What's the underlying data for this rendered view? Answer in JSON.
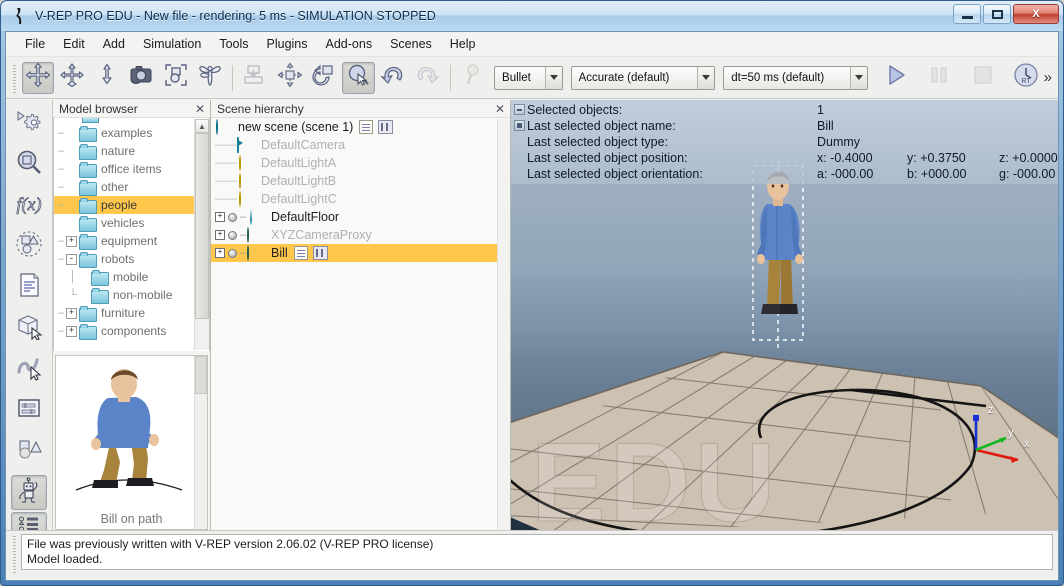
{
  "window": {
    "title": "V-REP PRO EDU - New file - rendering: 5 ms - SIMULATION STOPPED",
    "app_icon": "vrep-logo-icon",
    "minimize_label": "Minimize",
    "maximize_label": "Maximize",
    "close_label": "X"
  },
  "menubar": {
    "items": [
      {
        "label": "File"
      },
      {
        "label": "Edit"
      },
      {
        "label": "Add"
      },
      {
        "label": "Simulation"
      },
      {
        "label": "Tools"
      },
      {
        "label": "Plugins"
      },
      {
        "label": "Add-ons"
      },
      {
        "label": "Scenes"
      },
      {
        "label": "Help"
      }
    ]
  },
  "toolbar": {
    "buttons": [
      {
        "name": "object-shift-button",
        "icon": "four-way-arrows-icon",
        "state": "active"
      },
      {
        "name": "object-rotate-button",
        "icon": "rotate-arrows-icon",
        "state": "normal"
      },
      {
        "name": "camera-shift-button",
        "icon": "vertical-arrow-icon",
        "state": "normal"
      },
      {
        "name": "camera-button",
        "icon": "camera-icon",
        "state": "normal"
      },
      {
        "name": "fit-to-view-button",
        "icon": "bounding-box-icon",
        "state": "normal"
      },
      {
        "name": "fly-camera-button",
        "icon": "dragonfly-icon",
        "state": "normal"
      },
      {
        "name": "assemble-button",
        "icon": "assemble-icon",
        "state": "disabled"
      },
      {
        "name": "translate-tool-button",
        "icon": "move-object-icon",
        "state": "normal"
      },
      {
        "name": "rotate-tool-button",
        "icon": "rotate-object-icon",
        "state": "normal"
      },
      {
        "name": "selection-button",
        "icon": "select-cursor-icon",
        "state": "active"
      },
      {
        "name": "undo-button",
        "icon": "undo-arrow-icon",
        "state": "normal"
      },
      {
        "name": "redo-button",
        "icon": "redo-arrow-icon",
        "state": "disabled"
      },
      {
        "name": "page-selector-button",
        "icon": "pin-icon",
        "state": "disabled"
      }
    ],
    "engine_select": {
      "value": "Bullet",
      "name": "physics-engine-select"
    },
    "accuracy_select": {
      "value": "Accurate (default)",
      "name": "engine-accuracy-select"
    },
    "dt_select": {
      "value": "dt=50 ms (default)",
      "name": "simulation-timestep-select"
    },
    "start_button": {
      "name": "start-simulation-button",
      "icon": "play-icon"
    },
    "pause_button": {
      "name": "pause-simulation-button",
      "icon": "pause-icon"
    },
    "stop_button": {
      "name": "stop-simulation-button",
      "icon": "stop-icon"
    },
    "realtime_button": {
      "name": "realtime-mode-button",
      "icon": "clock-rt-icon",
      "badge": "RT"
    },
    "overflow": {
      "label": "»",
      "name": "toolbar-overflow-button"
    }
  },
  "vertical_toolbar": {
    "buttons": [
      {
        "name": "scene-object-properties-button",
        "icon": "gear-play-icon",
        "state": "normal"
      },
      {
        "name": "calculation-modules-button",
        "icon": "magnifier-cube-icon",
        "state": "normal"
      },
      {
        "name": "user-parameters-button",
        "icon": "fx-function-icon",
        "state": "normal"
      },
      {
        "name": "collection-button",
        "icon": "shapes-dashed-icon",
        "state": "normal"
      },
      {
        "name": "scripts-button",
        "icon": "script-page-icon",
        "state": "normal"
      },
      {
        "name": "shape-edit-button",
        "icon": "cube-cursor-icon",
        "state": "normal"
      },
      {
        "name": "path-edit-button",
        "icon": "path-cursor-icon",
        "state": "normal"
      },
      {
        "name": "dialog-button",
        "icon": "slider-dialog-icon",
        "state": "normal"
      },
      {
        "name": "geometry-button",
        "icon": "shapes-solid-icon",
        "state": "normal"
      },
      {
        "name": "model-browser-toggle-button",
        "icon": "robot-icon",
        "state": "active"
      },
      {
        "name": "scene-hierarchy-toggle-button",
        "icon": "hierarchy-list-icon",
        "state": "active"
      }
    ]
  },
  "model_browser": {
    "title": "Model browser",
    "close_label": "✕",
    "folders": [
      {
        "label": "examples",
        "expander": "",
        "selected": false,
        "indent": 0
      },
      {
        "label": "nature",
        "expander": "",
        "selected": false,
        "indent": 0
      },
      {
        "label": "office items",
        "expander": "",
        "selected": false,
        "indent": 0
      },
      {
        "label": "other",
        "expander": "",
        "selected": false,
        "indent": 0
      },
      {
        "label": "people",
        "expander": "",
        "selected": true,
        "indent": 0
      },
      {
        "label": "vehicles",
        "expander": "",
        "selected": false,
        "indent": 0
      },
      {
        "label": "equipment",
        "expander": "+",
        "selected": false,
        "indent": 0
      },
      {
        "label": "robots",
        "expander": "-",
        "selected": false,
        "indent": 0
      },
      {
        "label": "mobile",
        "expander": "",
        "selected": false,
        "indent": 1
      },
      {
        "label": "non-mobile",
        "expander": "",
        "selected": false,
        "indent": 1
      },
      {
        "label": "furniture",
        "expander": "+",
        "selected": false,
        "indent": 0
      },
      {
        "label": "components",
        "expander": "+",
        "selected": false,
        "indent": 0
      }
    ],
    "preview": {
      "caption": "Bill on path",
      "model_icon": "walking-man-model-icon"
    }
  },
  "scene_hierarchy": {
    "title": "Scene hierarchy",
    "close_label": "✕",
    "root": {
      "label": "new scene (scene 1)",
      "icon": "scene-globe-icon",
      "script_icon": "main-script-icon",
      "bars_icon": "scene-settings-icon"
    },
    "items": [
      {
        "label": "DefaultCamera",
        "icon": "camera-icon",
        "style": "dim",
        "expander": "",
        "selected": false,
        "child": true,
        "dot": false
      },
      {
        "label": "DefaultLightA",
        "icon": "light-icon",
        "style": "dim",
        "expander": "",
        "selected": false,
        "child": true,
        "dot": false
      },
      {
        "label": "DefaultLightB",
        "icon": "light-icon",
        "style": "dim",
        "expander": "",
        "selected": false,
        "child": true,
        "dot": false
      },
      {
        "label": "DefaultLightC",
        "icon": "light-icon",
        "style": "dim",
        "expander": "",
        "selected": false,
        "child": true,
        "dot": false
      },
      {
        "label": "DefaultFloor",
        "icon": "shape-drop-icon",
        "style": "dark",
        "expander": "+",
        "selected": false,
        "child": false,
        "dot": true
      },
      {
        "label": "XYZCameraProxy",
        "icon": "dummy-icon",
        "style": "dim",
        "expander": "+",
        "selected": false,
        "child": false,
        "dot": true
      },
      {
        "label": "Bill",
        "icon": "dummy-icon",
        "style": "dark",
        "expander": "+",
        "selected": true,
        "child": false,
        "dot": true,
        "script_icon": "child-script-icon",
        "bars_icon": "object-settings-icon"
      }
    ]
  },
  "viewport": {
    "info": {
      "rows": [
        {
          "label": "Selected objects:",
          "values": [
            "1"
          ]
        },
        {
          "label": "Last selected object name:",
          "values": [
            "Bill"
          ]
        },
        {
          "label": "Last selected object type:",
          "values": [
            "Dummy"
          ]
        },
        {
          "label": "Last selected object position:",
          "values": [
            "x: -0.4000",
            "y: +0.3750",
            "z: +0.0000"
          ]
        },
        {
          "label": "Last selected object orientation:",
          "values": [
            "a: -000.00",
            "b: +000.00",
            "g: -000.00"
          ]
        }
      ],
      "toggle_1": "info-collapse-toggle",
      "toggle_2": "info-expand-toggle"
    },
    "watermark": "EDU",
    "axes": {
      "x": "x",
      "y": "y",
      "z": "z",
      "x_color": "#e01b0e",
      "y_color": "#12b823",
      "z_color": "#1a2fd6"
    },
    "selected_object_label": "Bill",
    "floor_color": "#cdc1b2",
    "grid_color": "#6f675c",
    "path_color": "#141414"
  },
  "statusbar": {
    "lines": [
      "File was previously written with V-REP version 2.06.02 (V-REP PRO license)",
      "Model loaded."
    ]
  },
  "colors": {
    "selection_highlight": "#ffc84d",
    "titlebar_accent": "#4a7fb5",
    "panel_bg": "#efefed"
  }
}
